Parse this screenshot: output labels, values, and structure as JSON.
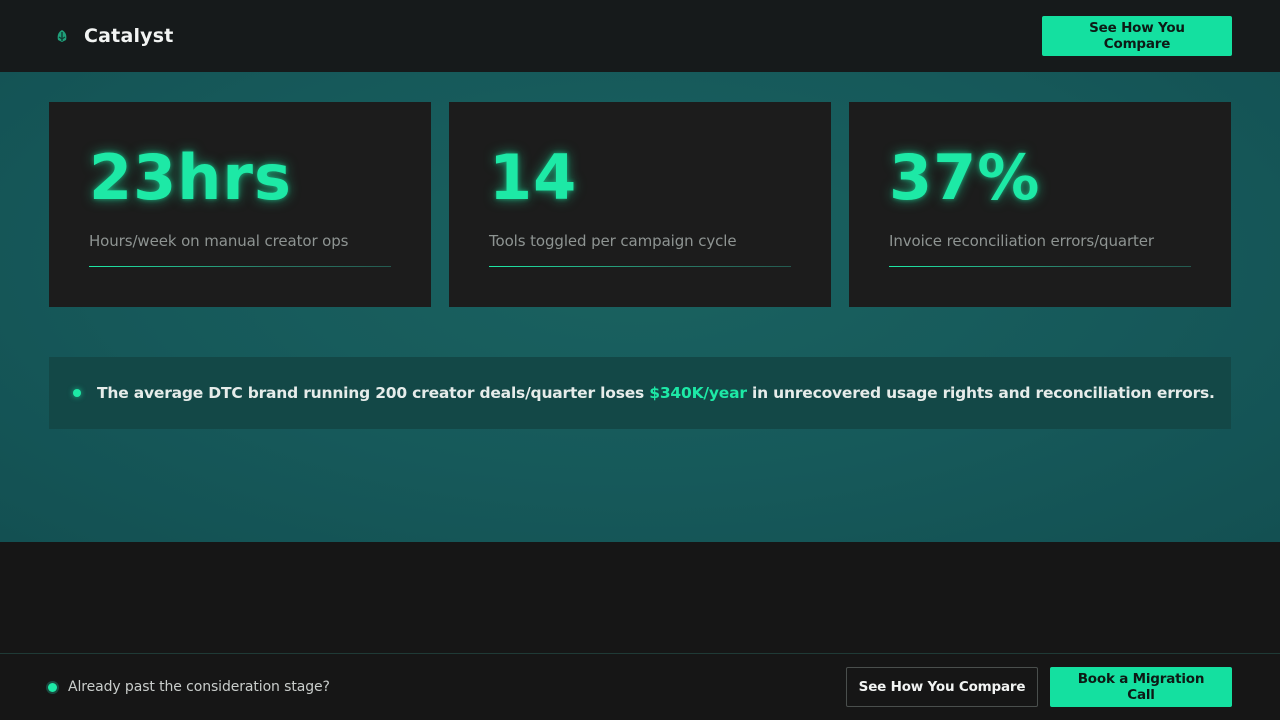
{
  "header": {
    "brand_name": "Catalyst",
    "logo_icon": "leaf-icon",
    "cta_label": "See How You Compare"
  },
  "stats": [
    {
      "value": "23hrs",
      "label": "Hours/week on manual creator ops"
    },
    {
      "value": "14",
      "label": "Tools toggled per campaign cycle"
    },
    {
      "value": "37%",
      "label": "Invoice reconciliation errors/quarter"
    }
  ],
  "insight": {
    "text_before": "The average DTC brand running 200 creator deals/quarter loses ",
    "highlight": "$340K/year",
    "text_after": " in unrecovered usage rights and reconciliation errors."
  },
  "footer": {
    "prompt": "Already past the consideration stage?",
    "secondary_label": "See How You Compare",
    "primary_label": "Book a Migration Call"
  },
  "colors": {
    "accent": "#1de9a6",
    "band": "#16595a",
    "card": "#1c1c1c",
    "page": "#161616"
  }
}
